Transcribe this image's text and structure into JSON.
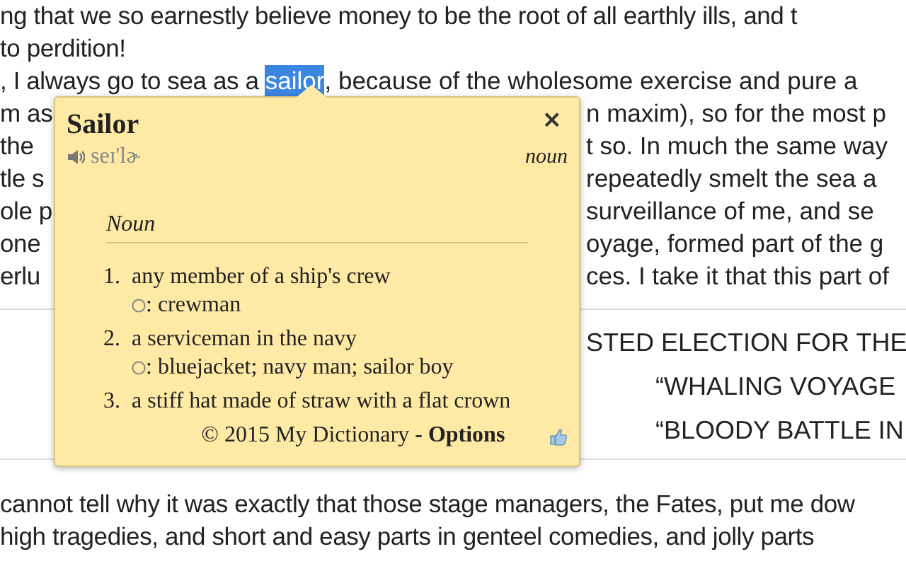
{
  "article": {
    "top_lines": [
      {
        "kind": "full",
        "parts": [
          {
            "text": "ng that we so earnestly believe money to be the root of all earthly ills, and t",
            "selected": false
          }
        ]
      },
      {
        "kind": "full",
        "parts": [
          {
            "text": "to perdition!",
            "selected": false
          }
        ]
      },
      {
        "kind": "full",
        "parts": [
          {
            "text": ", I always go to sea as a ",
            "selected": false
          },
          {
            "text": "sailor",
            "selected": true
          },
          {
            "text": ", because of the wholesome exercise and pure a",
            "selected": false
          }
        ]
      },
      {
        "kind": "split",
        "left": "m as",
        "right": "n maxim), so for the most p"
      },
      {
        "kind": "split",
        "left": "the",
        "right": "t so. In much the same way"
      },
      {
        "kind": "split",
        "left": "tle s",
        "right": "repeatedly smelt the sea a"
      },
      {
        "kind": "split",
        "left": "ole p",
        "right": "surveillance of me, and se"
      },
      {
        "kind": "split",
        "left": "one",
        "right": "oyage, formed part of the g"
      },
      {
        "kind": "split",
        "left": "erlu",
        "right": "ces. I take it that this part of"
      }
    ],
    "headings": [
      "STED ELECTION FOR THE",
      "“WHALING VOYAGE",
      "“BLOODY BATTLE IN"
    ],
    "bottom_lines": [
      "cannot tell why it was exactly that those stage managers, the Fates, put me dow",
      "high tragedies, and short and easy parts in genteel comedies, and jolly parts"
    ]
  },
  "popup": {
    "word": "Sailor",
    "pronunciation": "seɪ'lɚ",
    "part_of_speech": "noun",
    "section": "Noun",
    "definitions": [
      {
        "number": "1.",
        "text": "any member of a ship's crew",
        "synonyms": ": crewman"
      },
      {
        "number": "2.",
        "text": "a serviceman in the navy",
        "synonyms": ": bluejacket; navy man; sailor boy"
      },
      {
        "number": "3.",
        "text": "a stiff hat made of straw with a flat crown"
      }
    ],
    "close": "×",
    "footer": "© 2015 My Dictionary",
    "options_link": "- Options"
  }
}
